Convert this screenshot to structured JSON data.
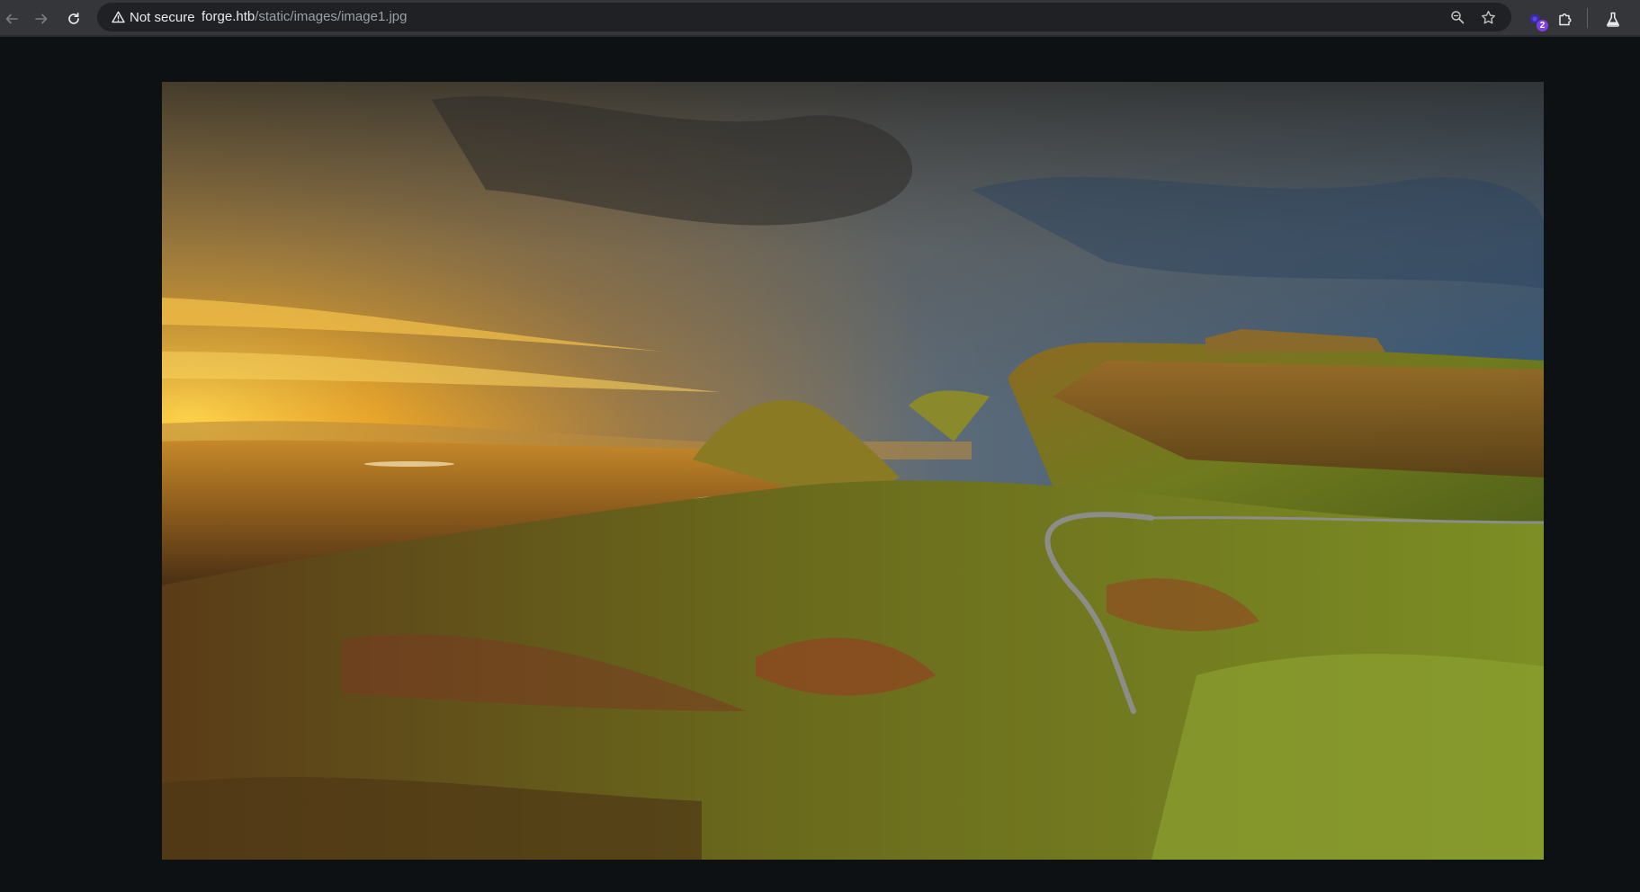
{
  "browser": {
    "security_label": "Not secure",
    "url_host": "forge.htb",
    "url_path": "/static/images/image1.jpg",
    "extension_badge": "2",
    "icons": {
      "back": "arrow-left-icon",
      "forward": "arrow-right-icon",
      "reload": "reload-icon",
      "warning": "warning-triangle-icon",
      "zoom": "zoom-icon",
      "bookmark": "star-icon",
      "extension": "extension-icon",
      "puzzle": "puzzle-icon",
      "labs": "flask-icon"
    }
  },
  "image": {
    "subject": "mountain landscape at sunrise",
    "palette": {
      "sky_warm": "#f2b431",
      "sky_cool": "#3f6a8f",
      "cloud_dark": "#3c3a36",
      "hill_green": "#7a8a22",
      "hill_dark": "#3a2a12",
      "lake": "#e9d8b0"
    }
  },
  "colors": {
    "toolbar_bg": "#35363a",
    "omnibox_bg": "#202124",
    "page_bg": "#0e1113",
    "text": "#e8eaed",
    "muted_text": "#9aa0a6",
    "accent_badge": "#7b3fe4"
  }
}
